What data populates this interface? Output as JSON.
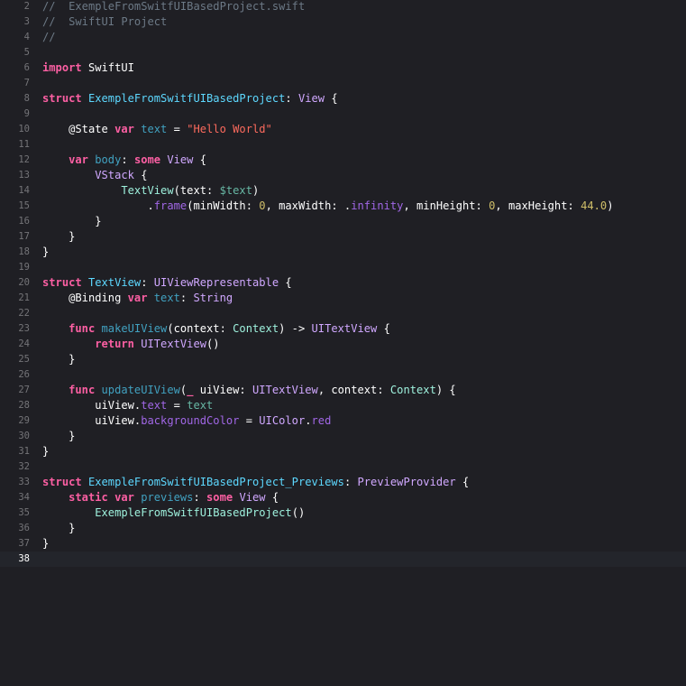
{
  "editor": {
    "colors": {
      "background": "#1f1f24",
      "current_line": "#23252b",
      "comment": "#6c7986",
      "keyword": "#fc5fa3",
      "string": "#fc6a5d",
      "number": "#d0bf69",
      "type_declaration": "#5dd8ff",
      "system_type": "#d0a8ff",
      "project_type": "#9ef1dd",
      "project_property": "#67b7a4",
      "system_property": "#a167e6",
      "declaration": "#41a1c0",
      "plain": "#ffffff"
    },
    "current_line_number": "38",
    "lines": [
      {
        "num": "2",
        "tokens": [
          {
            "t": "//  ExempleFromSwitfUIBasedProject.swift",
            "k": "comment"
          }
        ]
      },
      {
        "num": "3",
        "tokens": [
          {
            "t": "//  SwiftUI Project",
            "k": "comment"
          }
        ]
      },
      {
        "num": "4",
        "tokens": [
          {
            "t": "//",
            "k": "comment"
          }
        ]
      },
      {
        "num": "5",
        "tokens": []
      },
      {
        "num": "6",
        "tokens": [
          {
            "t": "import",
            "k": "keyword"
          },
          {
            "t": " SwiftUI",
            "k": "plain"
          }
        ]
      },
      {
        "num": "7",
        "tokens": []
      },
      {
        "num": "8",
        "tokens": [
          {
            "t": "struct",
            "k": "keyword"
          },
          {
            "t": " ",
            "k": "plain"
          },
          {
            "t": "ExempleFromSwitfUIBasedProject",
            "k": "typeDecl"
          },
          {
            "t": ": ",
            "k": "plain"
          },
          {
            "t": "View",
            "k": "type"
          },
          {
            "t": " {",
            "k": "plain"
          }
        ]
      },
      {
        "num": "9",
        "tokens": []
      },
      {
        "num": "10",
        "tokens": [
          {
            "t": "    @State ",
            "k": "attr"
          },
          {
            "t": "var",
            "k": "keyword"
          },
          {
            "t": " ",
            "k": "plain"
          },
          {
            "t": "text",
            "k": "varDecl"
          },
          {
            "t": " = ",
            "k": "plain"
          },
          {
            "t": "\"Hello World\"",
            "k": "string"
          }
        ]
      },
      {
        "num": "11",
        "tokens": []
      },
      {
        "num": "12",
        "tokens": [
          {
            "t": "    ",
            "k": "plain"
          },
          {
            "t": "var",
            "k": "keyword"
          },
          {
            "t": " ",
            "k": "plain"
          },
          {
            "t": "body",
            "k": "varDecl"
          },
          {
            "t": ": ",
            "k": "plain"
          },
          {
            "t": "some",
            "k": "keyword"
          },
          {
            "t": " ",
            "k": "plain"
          },
          {
            "t": "View",
            "k": "type"
          },
          {
            "t": " {",
            "k": "plain"
          }
        ]
      },
      {
        "num": "13",
        "tokens": [
          {
            "t": "        ",
            "k": "plain"
          },
          {
            "t": "VStack",
            "k": "type"
          },
          {
            "t": " {",
            "k": "plain"
          }
        ]
      },
      {
        "num": "14",
        "tokens": [
          {
            "t": "            ",
            "k": "plain"
          },
          {
            "t": "TextView",
            "k": "projType"
          },
          {
            "t": "(text: ",
            "k": "plain"
          },
          {
            "t": "$text",
            "k": "projProp"
          },
          {
            "t": ")",
            "k": "plain"
          }
        ]
      },
      {
        "num": "15",
        "tokens": [
          {
            "t": "                .",
            "k": "plain"
          },
          {
            "t": "frame",
            "k": "sysFunc"
          },
          {
            "t": "(minWidth: ",
            "k": "plain"
          },
          {
            "t": "0",
            "k": "number"
          },
          {
            "t": ", maxWidth: .",
            "k": "plain"
          },
          {
            "t": "infinity",
            "k": "sysProp"
          },
          {
            "t": ", minHeight: ",
            "k": "plain"
          },
          {
            "t": "0",
            "k": "number"
          },
          {
            "t": ", maxHeight: ",
            "k": "plain"
          },
          {
            "t": "44.0",
            "k": "number"
          },
          {
            "t": ")",
            "k": "plain"
          }
        ]
      },
      {
        "num": "16",
        "tokens": [
          {
            "t": "        }",
            "k": "plain"
          }
        ]
      },
      {
        "num": "17",
        "tokens": [
          {
            "t": "    }",
            "k": "plain"
          }
        ]
      },
      {
        "num": "18",
        "tokens": [
          {
            "t": "}",
            "k": "plain"
          }
        ]
      },
      {
        "num": "19",
        "tokens": []
      },
      {
        "num": "20",
        "tokens": [
          {
            "t": "struct",
            "k": "keyword"
          },
          {
            "t": " ",
            "k": "plain"
          },
          {
            "t": "TextView",
            "k": "typeDecl"
          },
          {
            "t": ": ",
            "k": "plain"
          },
          {
            "t": "UIViewRepresentable",
            "k": "type"
          },
          {
            "t": " {",
            "k": "plain"
          }
        ]
      },
      {
        "num": "21",
        "tokens": [
          {
            "t": "    @Binding ",
            "k": "attr"
          },
          {
            "t": "var",
            "k": "keyword"
          },
          {
            "t": " ",
            "k": "plain"
          },
          {
            "t": "text",
            "k": "varDecl"
          },
          {
            "t": ": ",
            "k": "plain"
          },
          {
            "t": "String",
            "k": "type"
          }
        ]
      },
      {
        "num": "22",
        "tokens": []
      },
      {
        "num": "23",
        "tokens": [
          {
            "t": "    ",
            "k": "plain"
          },
          {
            "t": "func",
            "k": "keyword"
          },
          {
            "t": " ",
            "k": "plain"
          },
          {
            "t": "makeUIView",
            "k": "funcDecl"
          },
          {
            "t": "(context: ",
            "k": "plain"
          },
          {
            "t": "Context",
            "k": "projType"
          },
          {
            "t": ") -> ",
            "k": "plain"
          },
          {
            "t": "UITextView",
            "k": "type"
          },
          {
            "t": " {",
            "k": "plain"
          }
        ]
      },
      {
        "num": "24",
        "tokens": [
          {
            "t": "        ",
            "k": "plain"
          },
          {
            "t": "return",
            "k": "keyword"
          },
          {
            "t": " ",
            "k": "plain"
          },
          {
            "t": "UITextView",
            "k": "type"
          },
          {
            "t": "()",
            "k": "plain"
          }
        ]
      },
      {
        "num": "25",
        "tokens": [
          {
            "t": "    }",
            "k": "plain"
          }
        ]
      },
      {
        "num": "26",
        "tokens": []
      },
      {
        "num": "27",
        "tokens": [
          {
            "t": "    ",
            "k": "plain"
          },
          {
            "t": "func",
            "k": "keyword"
          },
          {
            "t": " ",
            "k": "plain"
          },
          {
            "t": "updateUIView",
            "k": "funcDecl"
          },
          {
            "t": "(",
            "k": "plain"
          },
          {
            "t": "_",
            "k": "keyword"
          },
          {
            "t": " uiView: ",
            "k": "plain"
          },
          {
            "t": "UITextView",
            "k": "type"
          },
          {
            "t": ", context: ",
            "k": "plain"
          },
          {
            "t": "Context",
            "k": "projType"
          },
          {
            "t": ") {",
            "k": "plain"
          }
        ]
      },
      {
        "num": "28",
        "tokens": [
          {
            "t": "        uiView.",
            "k": "plain"
          },
          {
            "t": "text",
            "k": "sysProp"
          },
          {
            "t": " = ",
            "k": "plain"
          },
          {
            "t": "text",
            "k": "projProp"
          }
        ]
      },
      {
        "num": "29",
        "tokens": [
          {
            "t": "        uiView.",
            "k": "plain"
          },
          {
            "t": "backgroundColor",
            "k": "sysProp"
          },
          {
            "t": " = ",
            "k": "plain"
          },
          {
            "t": "UIColor",
            "k": "type"
          },
          {
            "t": ".",
            "k": "plain"
          },
          {
            "t": "red",
            "k": "sysProp"
          }
        ]
      },
      {
        "num": "30",
        "tokens": [
          {
            "t": "    }",
            "k": "plain"
          }
        ]
      },
      {
        "num": "31",
        "tokens": [
          {
            "t": "}",
            "k": "plain"
          }
        ]
      },
      {
        "num": "32",
        "tokens": []
      },
      {
        "num": "33",
        "tokens": [
          {
            "t": "struct",
            "k": "keyword"
          },
          {
            "t": " ",
            "k": "plain"
          },
          {
            "t": "ExempleFromSwitfUIBasedProject_Previews",
            "k": "typeDecl"
          },
          {
            "t": ": ",
            "k": "plain"
          },
          {
            "t": "PreviewProvider",
            "k": "type"
          },
          {
            "t": " {",
            "k": "plain"
          }
        ]
      },
      {
        "num": "34",
        "tokens": [
          {
            "t": "    ",
            "k": "plain"
          },
          {
            "t": "static",
            "k": "keyword"
          },
          {
            "t": " ",
            "k": "plain"
          },
          {
            "t": "var",
            "k": "keyword"
          },
          {
            "t": " ",
            "k": "plain"
          },
          {
            "t": "previews",
            "k": "varDecl"
          },
          {
            "t": ": ",
            "k": "plain"
          },
          {
            "t": "some",
            "k": "keyword"
          },
          {
            "t": " ",
            "k": "plain"
          },
          {
            "t": "View",
            "k": "type"
          },
          {
            "t": " {",
            "k": "plain"
          }
        ]
      },
      {
        "num": "35",
        "tokens": [
          {
            "t": "        ",
            "k": "plain"
          },
          {
            "t": "ExempleFromSwitfUIBasedProject",
            "k": "projType"
          },
          {
            "t": "()",
            "k": "plain"
          }
        ]
      },
      {
        "num": "36",
        "tokens": [
          {
            "t": "    }",
            "k": "plain"
          }
        ]
      },
      {
        "num": "37",
        "tokens": [
          {
            "t": "}",
            "k": "plain"
          }
        ]
      },
      {
        "num": "38",
        "tokens": []
      }
    ]
  }
}
